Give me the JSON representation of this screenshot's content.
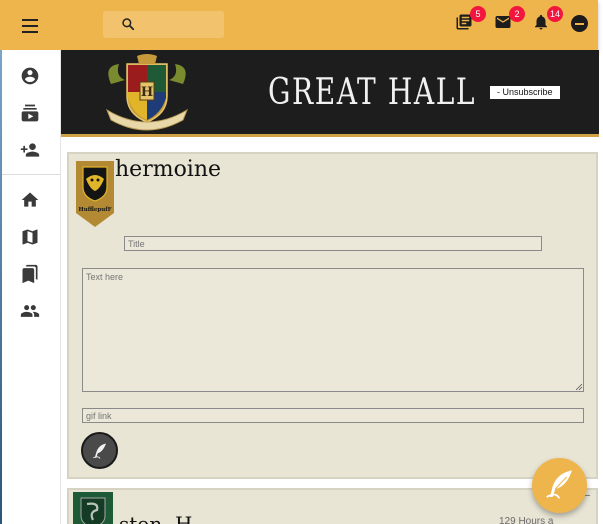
{
  "topbar": {
    "search_placeholder": "",
    "badges": {
      "library": "5",
      "mail": "2",
      "notifications": "14"
    }
  },
  "banner": {
    "title": "GREAT HALL",
    "unsubscribe_label": "- Unsubscribe",
    "crest_text": "H"
  },
  "composer": {
    "username": "hermoine",
    "house_flag_text": "HufflepufF",
    "title_placeholder": "Title",
    "text_placeholder": "Text here",
    "gif_placeholder": "gif link"
  },
  "next_post": {
    "username": "ston..H",
    "time": "129 Hours a"
  },
  "colors": {
    "accent": "#efb54d",
    "banner_bg": "#1d1d1d",
    "card_bg": "#e8e5d5",
    "badge": "#f2163e"
  },
  "icons": {
    "menu": "hamburger-icon",
    "search": "search-icon",
    "library": "library-books-icon",
    "mail": "mail-icon",
    "notifications": "bell-icon",
    "profile": "minus-circle-icon",
    "nav": [
      "account-circle-icon",
      "subscriptions-icon",
      "person-add-icon",
      "home-icon",
      "map-icon",
      "bookmarks-icon",
      "people-icon"
    ],
    "post": "quill-icon",
    "fab": "quill-icon"
  }
}
